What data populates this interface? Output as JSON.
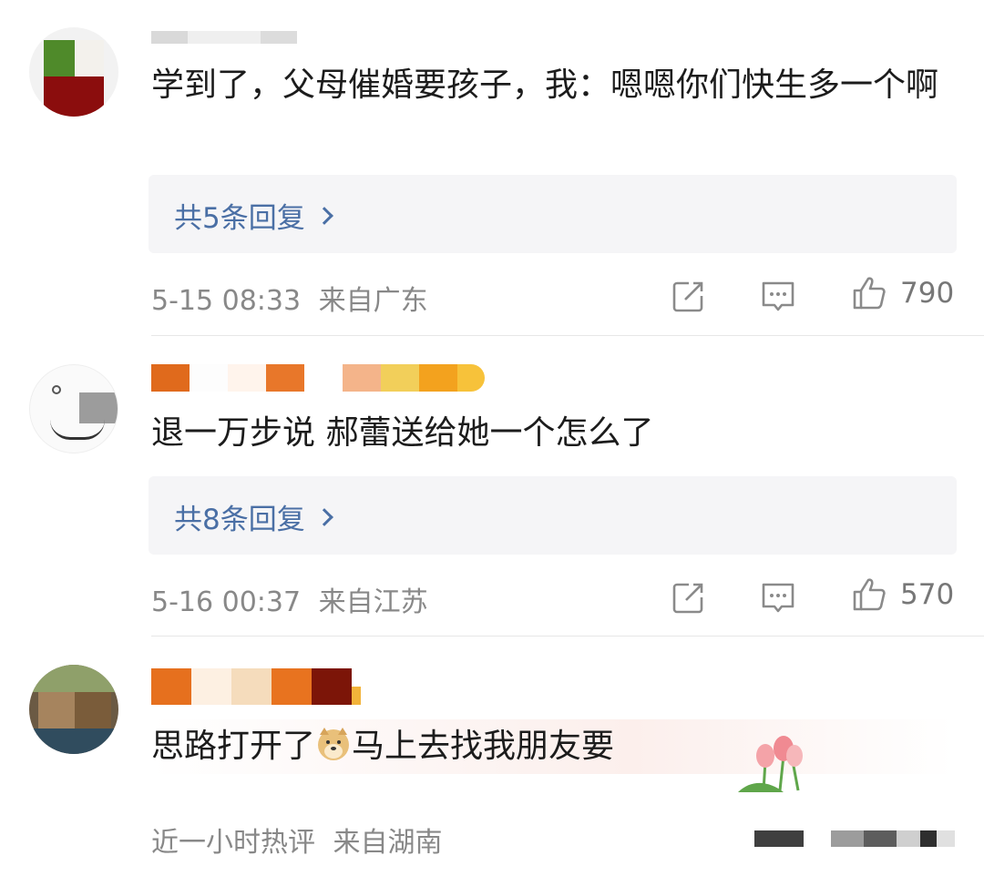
{
  "comments": [
    {
      "text": "学到了，父母催婚要孩子，我：嗯嗯你们快生多一个啊",
      "reply_label": "共5条回复",
      "time": "5-15 08:33",
      "location": "来自广东",
      "likes": "790"
    },
    {
      "text": "退一万步说 郝蕾送给她一个怎么了",
      "reply_label": "共8条回复",
      "time": "5-16 00:37",
      "location": "来自江苏",
      "likes": "570"
    },
    {
      "text_before": "思路打开了",
      "text_after": "马上去找我朋友要",
      "time": "近一小时热评",
      "location": "来自湖南"
    }
  ],
  "icons": {
    "share": "share-icon",
    "comment": "comment-icon",
    "like": "thumbs-up-icon",
    "reply_chevron": "chevron-right-icon",
    "doge": "doge-emoji-icon",
    "decoration": "tulip-sticker-icon"
  },
  "colors": {
    "reply_link": "#4a6fa5",
    "reply_bg": "#f5f5f7",
    "meta": "#888888"
  }
}
